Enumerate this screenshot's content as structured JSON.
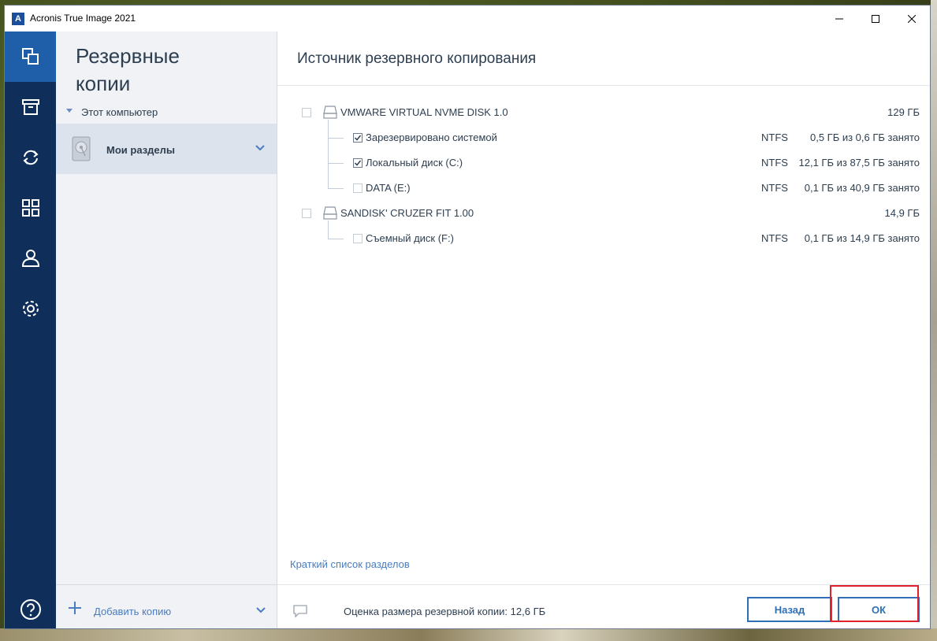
{
  "window": {
    "title": "Acronis True Image 2021",
    "logo_letter": "A",
    "brand_color": "#1b4f9c"
  },
  "nav": {
    "items": [
      {
        "icon": "copy-icon",
        "active": true
      },
      {
        "icon": "archive-icon",
        "active": false
      },
      {
        "icon": "sync-icon",
        "active": false
      },
      {
        "icon": "grid-icon",
        "active": false
      },
      {
        "icon": "user-icon",
        "active": false
      },
      {
        "icon": "gear-icon",
        "active": false
      }
    ],
    "help_icon": "help-icon"
  },
  "sidebar": {
    "title_line1": "Резервные",
    "title_line2": "копии",
    "group_label": "Этот компьютер",
    "item_label": "Мои разделы",
    "add_label": "Добавить копию"
  },
  "main": {
    "title": "Источник резервного копирования",
    "disks": [
      {
        "name": "VMWARE VIRTUAL NVME DISK 1.0",
        "size": "129 ГБ",
        "checked": false,
        "partitions": [
          {
            "name": "Зарезервировано системой",
            "fs": "NTFS",
            "usage": "0,5 ГБ из 0,6 ГБ занято",
            "checked": true
          },
          {
            "name": "Локальный диск (C:)",
            "fs": "NTFS",
            "usage": "12,1 ГБ из 87,5 ГБ занято",
            "checked": true
          },
          {
            "name": "DATA (E:)",
            "fs": "NTFS",
            "usage": "0,1 ГБ из 40,9 ГБ занято",
            "checked": false
          }
        ]
      },
      {
        "name": "SANDISK' CRUZER FIT 1.00",
        "size": "14,9 ГБ",
        "checked": false,
        "partitions": [
          {
            "name": "Съемный диск (F:)",
            "fs": "NTFS",
            "usage": "0,1 ГБ из 14,9 ГБ занято",
            "checked": false
          }
        ]
      }
    ],
    "short_list_link": "Краткий список разделов",
    "estimate_label": "Оценка размера резервной копии:",
    "estimate_value": "12,6 ГБ",
    "back_label": "Назад",
    "ok_label": "ОК"
  }
}
